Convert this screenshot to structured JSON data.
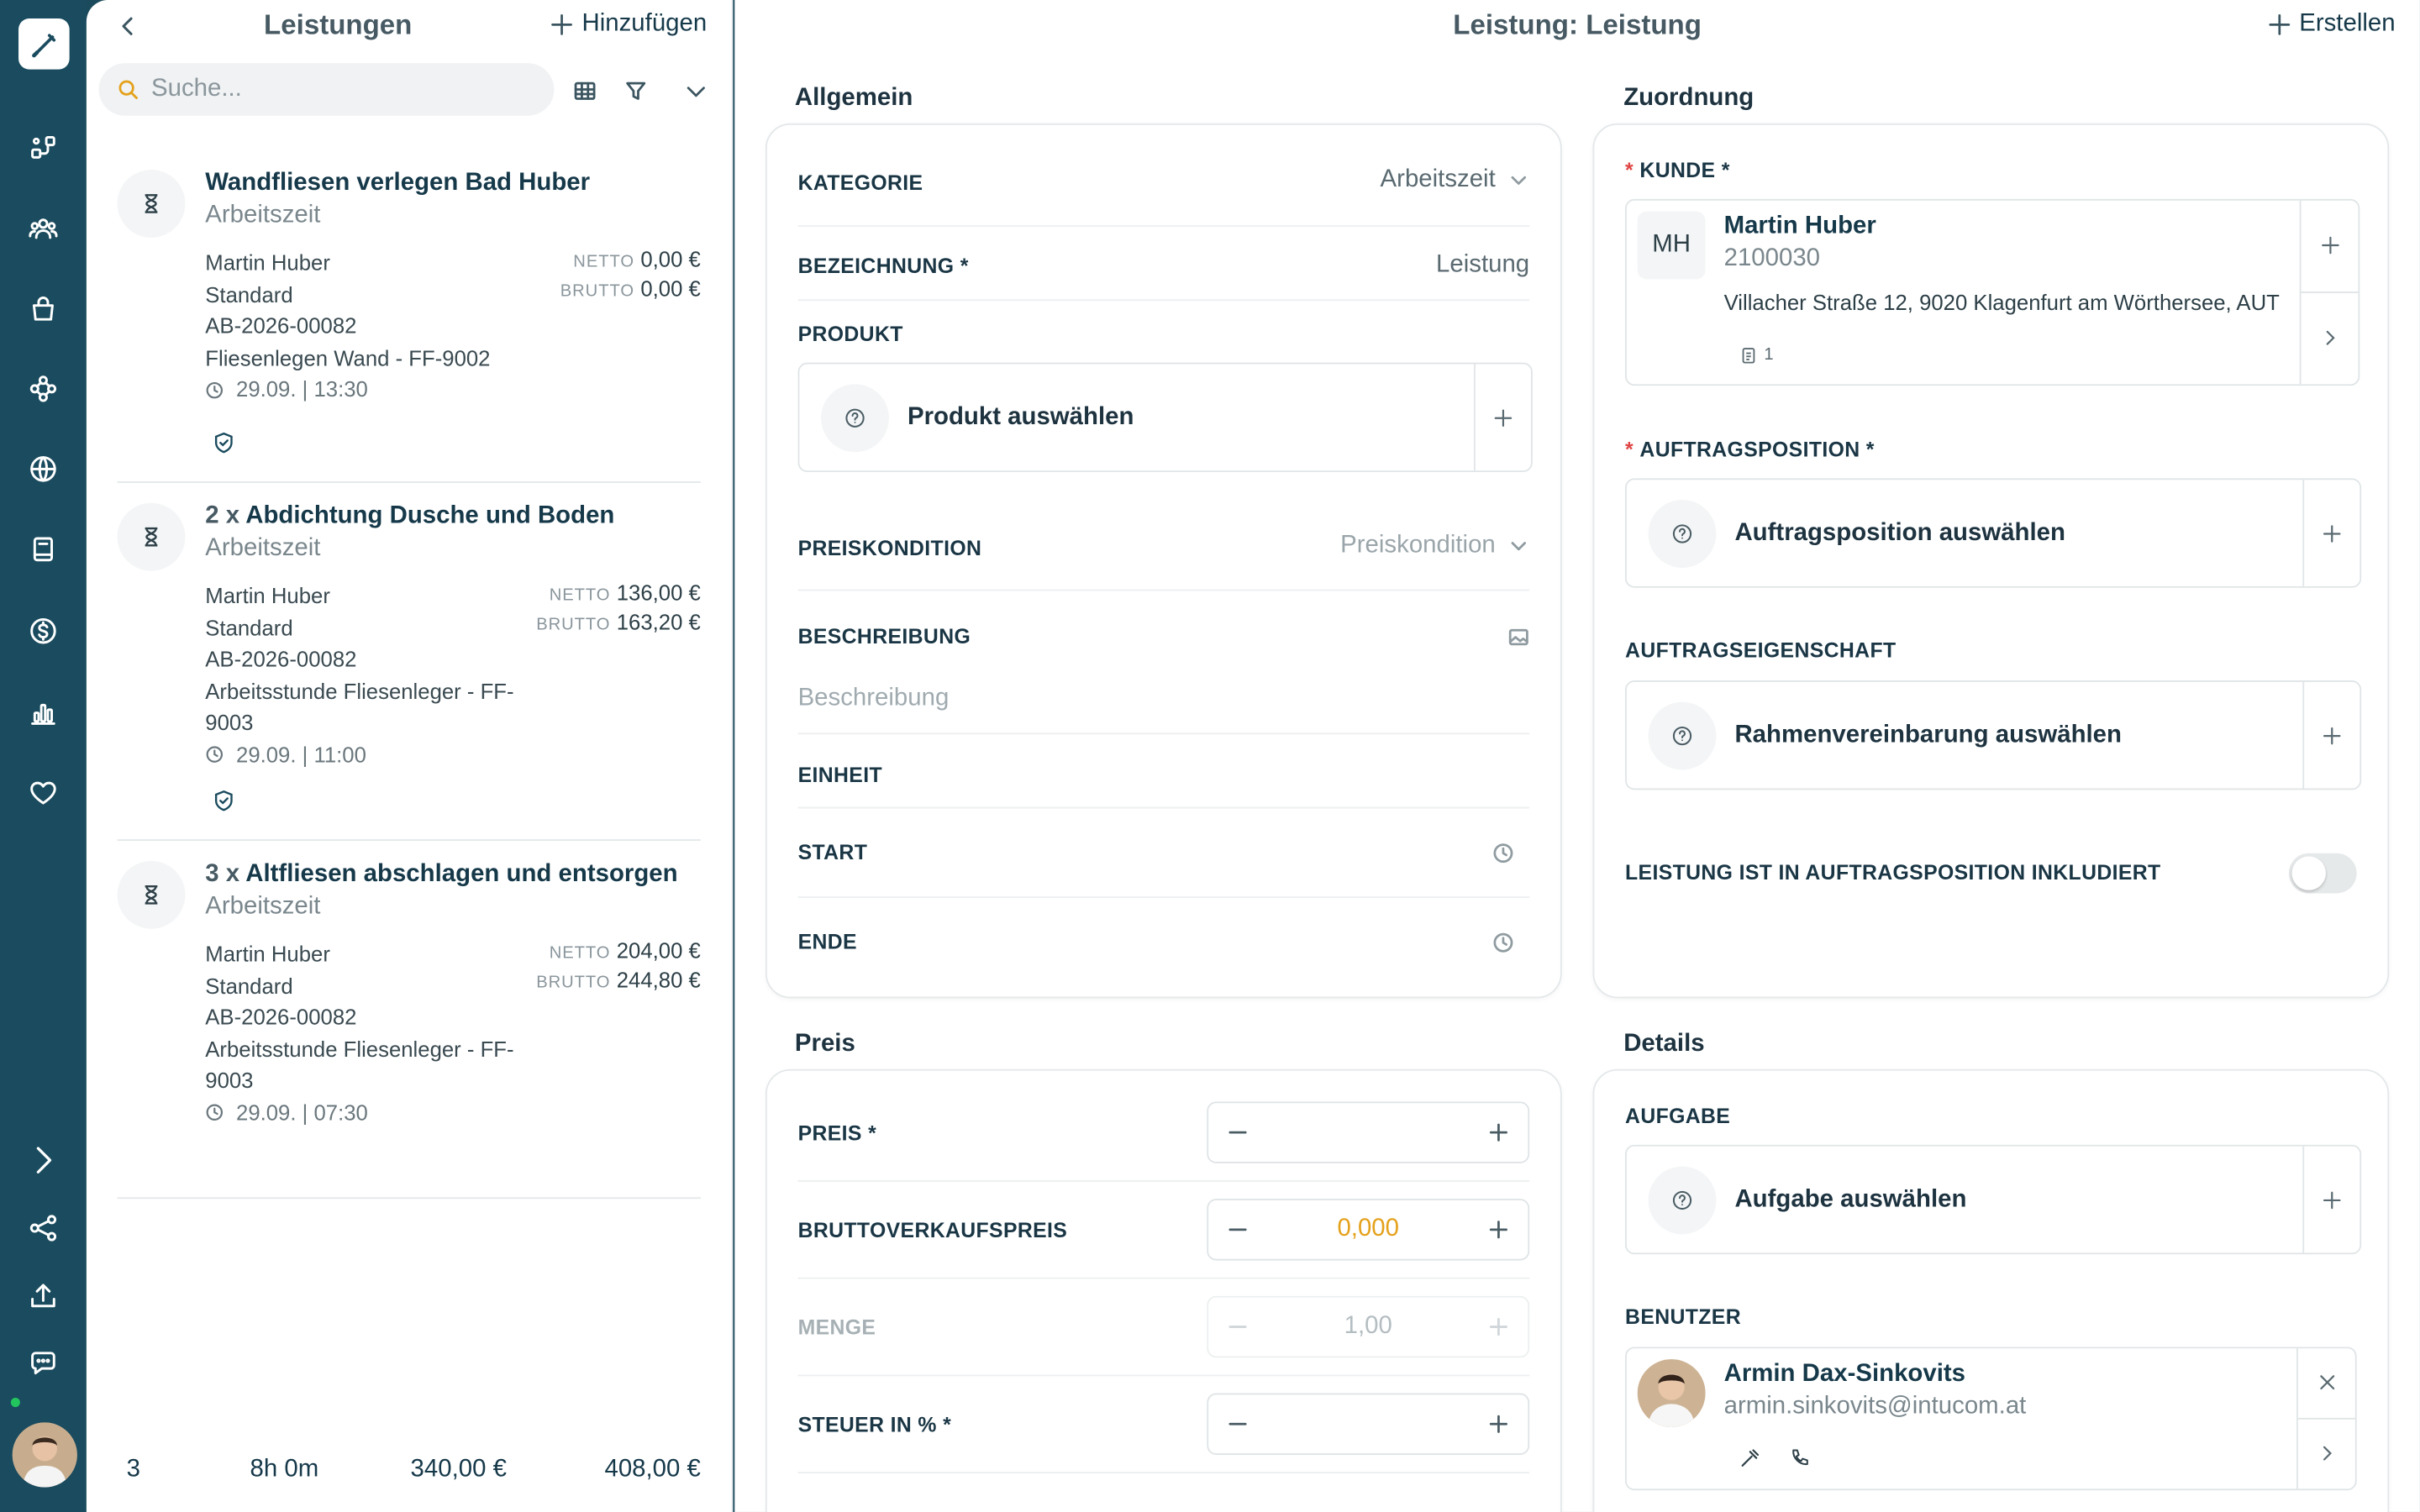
{
  "list": {
    "title": "Leistungen",
    "add_label": "Hinzufügen",
    "search_placeholder": "Suche...",
    "items": [
      {
        "qty": "",
        "title": "Wandfliesen verlegen Bad Huber",
        "category": "Arbeitszeit",
        "customer": "Martin Huber",
        "price_group": "Standard",
        "order": "AB-2026-00082",
        "position": "Fliesenlegen Wand - FF-9002",
        "time": "29.09. | 13:30",
        "netto_label": "NETTO",
        "netto": "0,00 €",
        "brutto_label": "BRUTTO",
        "brutto": "0,00 €"
      },
      {
        "qty": "2 x",
        "title": "Abdichtung Dusche und Boden",
        "category": "Arbeitszeit",
        "customer": "Martin Huber",
        "price_group": "Standard",
        "order": "AB-2026-00082",
        "position": "Arbeitsstunde Fliesenleger - FF-9003",
        "time": "29.09. | 11:00",
        "netto_label": "NETTO",
        "netto": "136,00 €",
        "brutto_label": "BRUTTO",
        "brutto": "163,20 €"
      },
      {
        "qty": "3 x",
        "title": "Altfliesen abschlagen und entsorgen",
        "category": "Arbeitszeit",
        "customer": "Martin Huber",
        "price_group": "Standard",
        "order": "AB-2026-00082",
        "position": "Arbeitsstunde Fliesenleger - FF-9003",
        "time": "29.09. | 07:30",
        "netto_label": "NETTO",
        "netto": "204,00 €",
        "brutto_label": "BRUTTO",
        "brutto": "244,80 €"
      }
    ],
    "footer": {
      "count": "3",
      "duration": "8h 0m",
      "netto_total": "340,00 €",
      "brutto_total": "408,00 €"
    }
  },
  "detail": {
    "title": "Leistung: Leistung",
    "create_label": "Erstellen",
    "allgemein": {
      "heading": "Allgemein",
      "kategorie_label": "KATEGORIE",
      "kategorie_value": "Arbeitszeit",
      "bezeichnung_label": "BEZEICHNUNG *",
      "bezeichnung_value": "Leistung",
      "produkt_label": "PRODUKT",
      "produkt_placeholder": "Produkt auswählen",
      "preiskondition_label": "PREISKONDITION",
      "preiskondition_placeholder": "Preiskondition",
      "beschreibung_label": "BESCHREIBUNG",
      "beschreibung_placeholder": "Beschreibung",
      "einheit_label": "EINHEIT",
      "start_label": "START",
      "ende_label": "ENDE"
    },
    "zuordnung": {
      "heading": "Zuordnung",
      "kunde_label": "KUNDE *",
      "kunde_initials": "MH",
      "kunde_name": "Martin Huber",
      "kunde_number": "2100030",
      "kunde_address": "Villacher Straße 12, 9020 Klagenfurt am Wörthersee, AUT",
      "kunde_doc_count": "1",
      "auftragsposition_label": "AUFTRAGSPOSITION *",
      "auftragsposition_placeholder": "Auftragsposition auswählen",
      "auftragseigenschaft_label": "AUFTRAGSEIGENSCHAFT",
      "auftragseigenschaft_placeholder": "Rahmenvereinbarung auswählen",
      "inkludiert_label": "LEISTUNG IST IN AUFTRAGSPOSITION INKLUDIERT"
    },
    "preis": {
      "heading": "Preis",
      "preis_label": "PREIS *",
      "preis_value": "",
      "brutto_label": "BRUTTOVERKAUFSPREIS",
      "brutto_value": "0,000",
      "menge_label": "MENGE",
      "menge_value": "1,00",
      "steuer_label": "STEUER IN % *",
      "steuer_value": ""
    },
    "details": {
      "heading": "Details",
      "aufgabe_label": "AUFGABE",
      "aufgabe_placeholder": "Aufgabe auswählen",
      "benutzer_label": "BENUTZER",
      "user_name": "Armin Dax-Sinkovits",
      "user_email": "armin.sinkovits@intucom.at"
    }
  },
  "rail": {
    "icons": [
      "pen-icon",
      "workflow-icon",
      "users-icon",
      "bag-icon",
      "network-icon",
      "globe-icon",
      "book-icon",
      "dollar-icon",
      "chart-icon",
      "heart-icon",
      "expand-icon",
      "share-icon",
      "upload-icon",
      "chat-icon"
    ]
  },
  "colors": {
    "rail": "#1a4b5e",
    "accent_value": "#e4a11b",
    "required": "#e04545",
    "online": "#22c55e"
  }
}
